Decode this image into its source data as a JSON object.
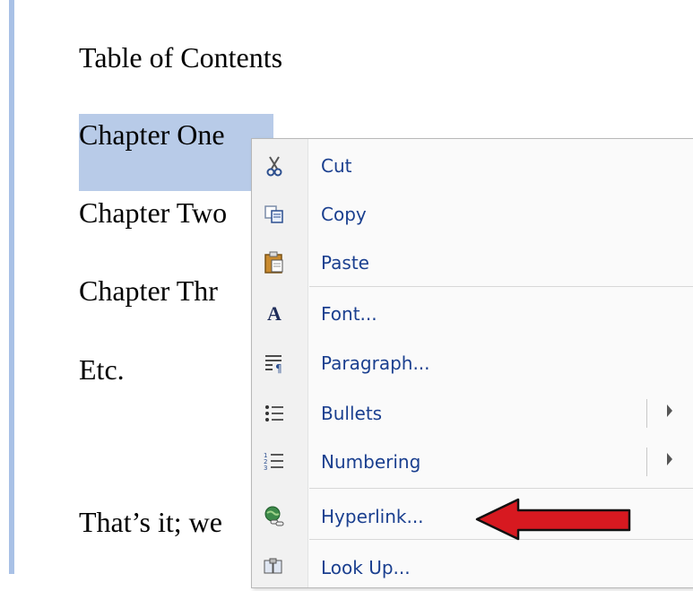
{
  "document": {
    "lines": [
      "Table of Contents",
      "Chapter One",
      "Chapter Two",
      "Chapter Thr",
      "Etc.",
      "That’s it; we"
    ]
  },
  "context_menu": {
    "items": [
      {
        "label": "Cut",
        "icon": "scissors-icon"
      },
      {
        "label": "Copy",
        "icon": "copy-icon"
      },
      {
        "label": "Paste",
        "icon": "clipboard-icon"
      },
      {
        "label": "Font...",
        "icon": "font-icon"
      },
      {
        "label": "Paragraph...",
        "icon": "paragraph-icon"
      },
      {
        "label": "Bullets",
        "icon": "bullets-icon",
        "submenu": true
      },
      {
        "label": "Numbering",
        "icon": "numbering-icon",
        "submenu": true
      },
      {
        "label": "Hyperlink...",
        "icon": "hyperlink-icon"
      },
      {
        "label": "Look Up...",
        "icon": "look-up-icon"
      }
    ]
  },
  "annotation": {
    "arrow_color": "#d71920"
  }
}
